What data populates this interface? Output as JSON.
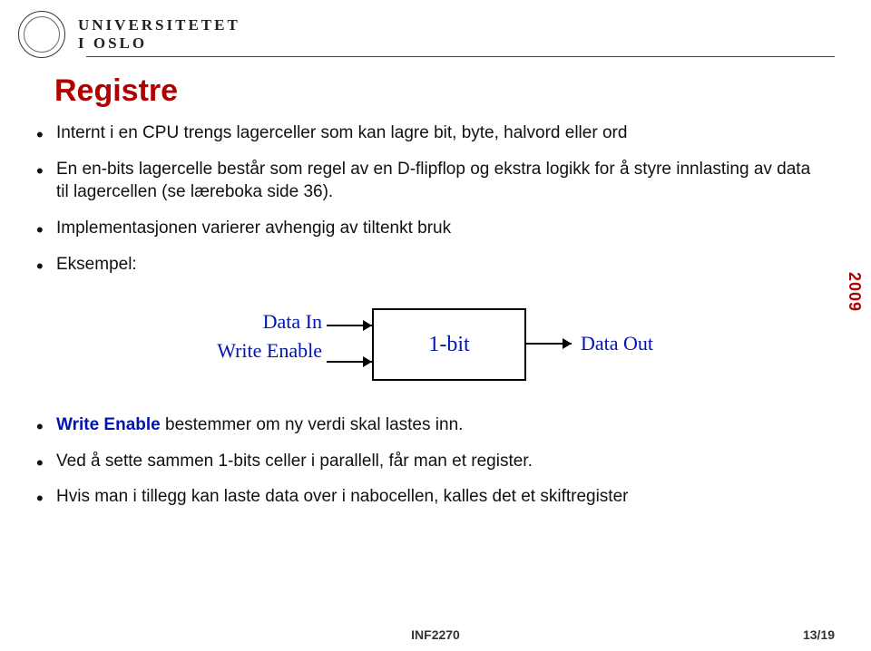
{
  "header": {
    "uni_line1": "UNIVERSITETET",
    "uni_line2": "I OSLO"
  },
  "slide": {
    "title": "Registre",
    "bullets": [
      "Internt i en CPU trengs lagerceller som kan lagre bit, byte, halvord eller ord",
      "En en-bits lagercelle består som regel av en D-flipflop og ekstra logikk for å styre innlasting av data til lagercellen (se læreboka side 36).",
      "Implementasjonen varierer avhengig av tiltenkt bruk",
      "Eksempel:"
    ],
    "bullets2_pre": "Write Enable",
    "bullets2_rest": " bestemmer om ny verdi skal lastes inn.",
    "bullets3": "Ved å sette sammen 1-bits celler i parallell, får man et register.",
    "bullets4": "Hvis man i tillegg kan laste data over i nabocellen, kalles det et skiftregister"
  },
  "diagram": {
    "data_in": "Data In",
    "write_enable": "Write Enable",
    "box": "1-bit",
    "data_out": "Data Out"
  },
  "chart_data": {
    "type": "diagram-block",
    "inputs": [
      "Data In",
      "Write Enable"
    ],
    "block_label": "1-bit",
    "outputs": [
      "Data Out"
    ]
  },
  "year": "2009",
  "footer": {
    "course": "INF2270",
    "page": "13/19"
  }
}
